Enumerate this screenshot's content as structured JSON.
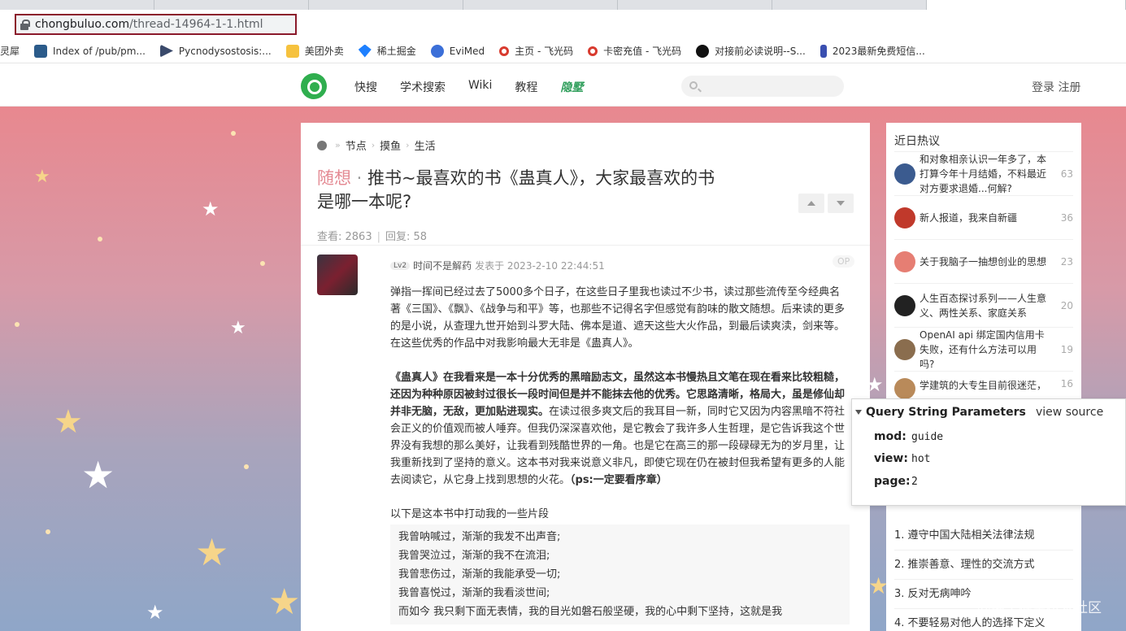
{
  "browser": {
    "url_host": "chongbuluo.com",
    "url_path": "/thread-14964-1-1.html"
  },
  "bookmarks": [
    {
      "label": "灵犀",
      "icon": "bookmark-icon",
      "color": "#ffffff"
    },
    {
      "label": "Index of /pub/pm...",
      "icon": "folder-icon",
      "color": "#2b5b8a"
    },
    {
      "label": "Pycnodysostosis:...",
      "icon": "arrow-icon",
      "color": "#3a4a6b"
    },
    {
      "label": "美团外卖",
      "icon": "meituan-icon",
      "color": "#f6c23e"
    },
    {
      "label": "稀土掘金",
      "icon": "juejin-icon",
      "color": "#1e80ff"
    },
    {
      "label": "EviMed",
      "icon": "evimed-icon",
      "color": "#3b6fd8"
    },
    {
      "label": "主页 - 飞光码",
      "icon": "feiguang-icon",
      "color": "#d83a2e"
    },
    {
      "label": "卡密充值 - 飞光码",
      "icon": "feiguang-icon",
      "color": "#d83a2e"
    },
    {
      "label": "对接前必读说明--S...",
      "icon": "s-icon",
      "color": "#111111"
    },
    {
      "label": "2023最新免费短信...",
      "icon": "hourglass-icon",
      "color": "#3a4fb0"
    }
  ],
  "site": {
    "nav": [
      "快搜",
      "学术搜索",
      "Wiki",
      "教程"
    ],
    "nav_special": "隐墅",
    "auth": "登录 注册"
  },
  "post": {
    "breadcrumb": [
      "节点",
      "摸鱼",
      "生活"
    ],
    "tag": "随想",
    "title_line1": "推书~最喜欢的书《蛊真人》，大家最喜欢的书",
    "title_line2": "是哪一本呢?",
    "views_label": "查看: 2863",
    "replies_label": "回复: 58",
    "level": "Lv2",
    "author": "时间不是解药",
    "posted": "发表于 2023-2-10 22:44:51",
    "op_badge": "OP",
    "p1": "弹指一挥间已经过去了5000多个日子，在这些日子里我也读过不少书，读过那些流传至今经典名著《三国》、《飘》、《战争与和平》等，也那些不记得名字但感觉有韵味的散文随想。后来读的更多的是小说，从查理九世开始到斗罗大陆、佛本是道、遮天这些大火作品，到最后读爽渎，剑来等。在这些优秀的作品中对我影响最大无非是《蛊真人》。",
    "p2_bold": "《蛊真人》在我看来是一本十分优秀的黑暗励志文，虽然这本书慢热且文笔在现在看来比较粗糙，还因为种种原因被封过很长一段时间但是并不能抹去他的优秀。它思路清晰，格局大，虽是修仙却并非无脑，无敌，更加贴进现实。",
    "p2_rest": "在读过很多爽文后的我耳目一新，同时它又因为内容黑暗不符社会正义的价值观而被人唾弃。但我仍深深喜欢他，是它教会了我许多人生哲理，是它告诉我这个世界没有我想的那么美好，让我看到残酷世界的一角。也是它在高三的那一段碌碌无为的岁月里，让我重新找到了坚持的意义。这本书对我来说意义非凡，即使它现在仍在被封但我希望有更多的人能去阅读它，从它身上找到思想的火花。",
    "p2_ps": "（ps:一定要看序章）",
    "p3": "以下是这本书中打动我的一些片段",
    "quote": [
      "我曾呐喊过，渐渐的我发不出声音;",
      "我曾哭泣过，渐渐的我不在流泪;",
      "我曾悲伤过，渐渐的我能承受一切;",
      "我曾喜悦过，渐渐的我看淡世间;",
      "而如今 我只剩下面无表情，我的目光如磐石般坚硬，我的心中剩下坚持，这就是我"
    ]
  },
  "sidebar": {
    "title": "近日热议",
    "hot": [
      {
        "text": "和对象相亲认识一年多了，本打算今年十月结婚，不料最近对方要求退婚...何解?",
        "count": "63",
        "color": "#3b5b8f"
      },
      {
        "text": "新人报道，我来自新疆",
        "count": "36",
        "color": "#c0392b"
      },
      {
        "text": "关于我脑子一抽想创业的思想",
        "count": "23",
        "color": "#e67e73"
      },
      {
        "text": "人生百态探讨系列——人生意义、两性关系、家庭关系",
        "count": "20",
        "color": "#222222"
      },
      {
        "text": "OpenAI api 绑定国内信用卡失败，还有什么方法可以用吗?",
        "count": "19",
        "color": "#8a6d4e"
      },
      {
        "text": "学建筑的大专生目前很迷茫，",
        "count": "16",
        "color": "#b98a5a"
      }
    ],
    "rules": [
      "1. 遵守中国大陆相关法律法规",
      "2. 推崇善意、理性的交流方式",
      "3. 反对无病呻吟",
      "4. 不要轻易对他人的选择下定义"
    ]
  },
  "devtools": {
    "section": "Query String Parameters",
    "view_source": "view source",
    "params": [
      {
        "key": "mod:",
        "value": "guide"
      },
      {
        "key": "view:",
        "value": "hot"
      },
      {
        "key": "page:",
        "value": "2"
      }
    ]
  },
  "watermark": "@稀土掘金技术社区"
}
